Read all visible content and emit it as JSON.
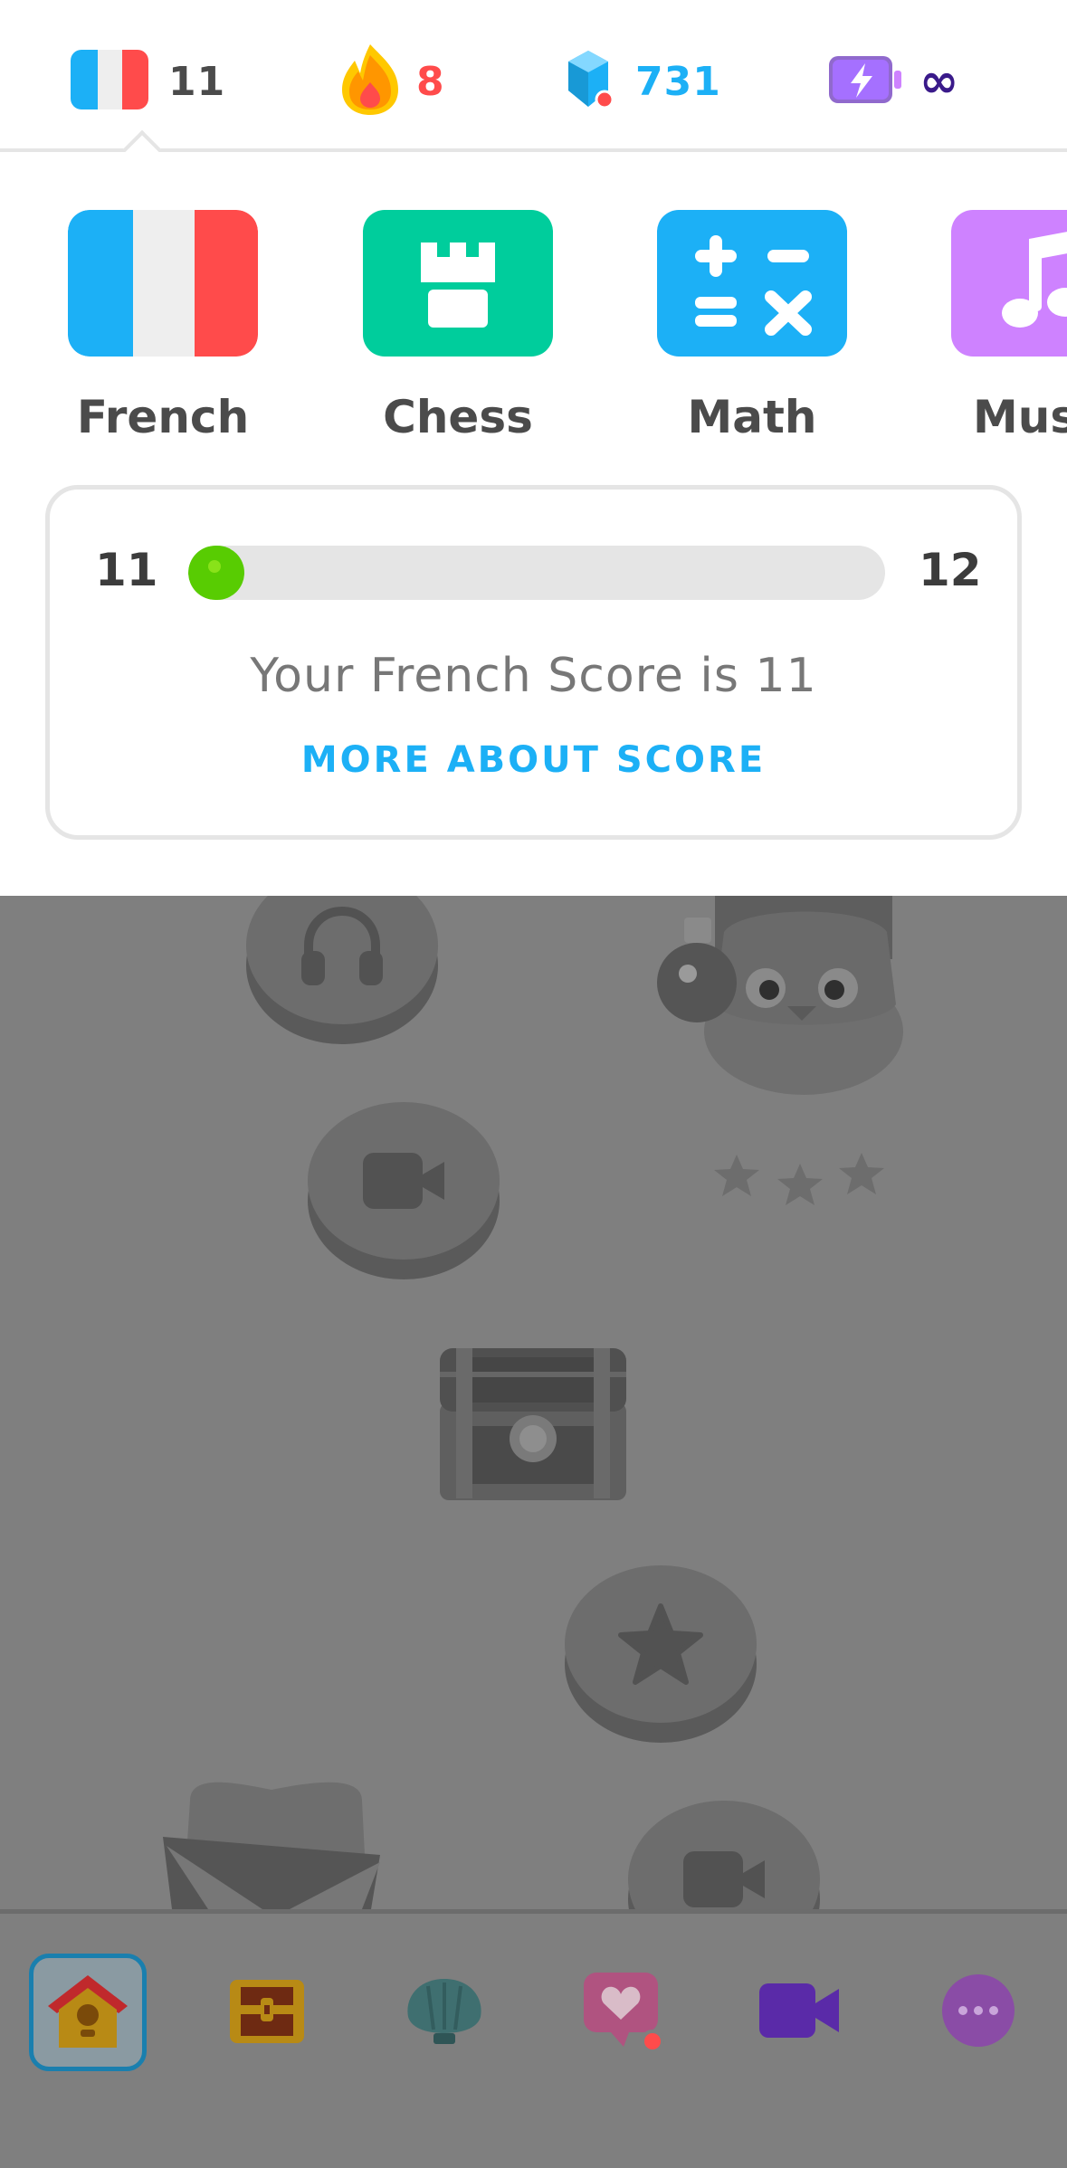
{
  "stats": {
    "course_count": "11",
    "streak": "8",
    "gems": "731",
    "energy": "∞"
  },
  "courses": [
    {
      "name": "French",
      "icon": "french-flag-icon",
      "selected": true
    },
    {
      "name": "Chess",
      "icon": "chess-rook-icon",
      "selected": false
    },
    {
      "name": "Math",
      "icon": "math-operators-icon",
      "selected": false
    },
    {
      "name": "Music",
      "icon": "music-note-icon",
      "selected": false
    }
  ],
  "score": {
    "current": "11",
    "next": "12",
    "progress": 0.08,
    "text": "Your French Score is 11",
    "link": "MORE ABOUT SCORE"
  },
  "path": {
    "nodes": [
      "headphones-icon",
      "video-camera-icon",
      "treasure-chest-icon",
      "star-icon",
      "video-camera-icon"
    ],
    "character": "duo-owl-character"
  },
  "nav": [
    {
      "icon": "home-icon",
      "selected": true
    },
    {
      "icon": "treasure-chest-icon",
      "selected": false
    },
    {
      "icon": "shell-icon",
      "selected": false
    },
    {
      "icon": "heart-chat-icon",
      "selected": false
    },
    {
      "icon": "video-camera-icon",
      "selected": false
    },
    {
      "icon": "more-icon",
      "selected": false
    }
  ],
  "colors": {
    "accent_blue": "#1cb0f6",
    "streak_orange": "#ff9600",
    "progress_green": "#58cc02",
    "gems_blue": "#1cb0f6",
    "energy_purple": "#6a11cb",
    "chess_green": "#00cd9c",
    "music_purple": "#ce82ff"
  }
}
